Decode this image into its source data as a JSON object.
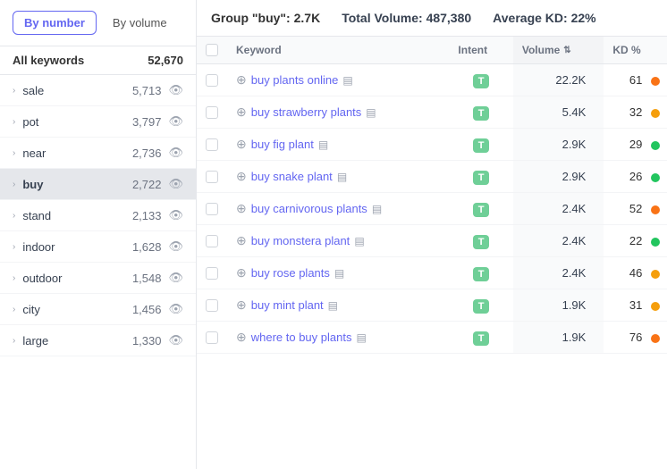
{
  "sidebar": {
    "buttons": {
      "by_number": "By number",
      "by_volume": "By volume"
    },
    "all_keywords_label": "All keywords",
    "all_keywords_count": "52,670",
    "items": [
      {
        "label": "sale",
        "count": "5,713"
      },
      {
        "label": "pot",
        "count": "3,797"
      },
      {
        "label": "near",
        "count": "2,736"
      },
      {
        "label": "buy",
        "count": "2,722",
        "active": true
      },
      {
        "label": "stand",
        "count": "2,133"
      },
      {
        "label": "indoor",
        "count": "1,628"
      },
      {
        "label": "outdoor",
        "count": "1,548"
      },
      {
        "label": "city",
        "count": "1,456"
      },
      {
        "label": "large",
        "count": "1,330"
      }
    ]
  },
  "header": {
    "group_label": "Group \"buy\":",
    "group_value": "2.7K",
    "total_volume_label": "Total Volume:",
    "total_volume_value": "487,380",
    "avg_kd_label": "Average KD:",
    "avg_kd_value": "22%"
  },
  "table": {
    "columns": {
      "checkbox": "",
      "keyword": "Keyword",
      "intent": "Intent",
      "volume": "Volume",
      "kd": "KD %"
    },
    "rows": [
      {
        "keyword": "buy plants online",
        "intent": "T",
        "volume": "22.2K",
        "kd": 61,
        "kd_color": "#f97316"
      },
      {
        "keyword": "buy strawberry plants",
        "intent": "T",
        "volume": "5.4K",
        "kd": 32,
        "kd_color": "#f59e0b"
      },
      {
        "keyword": "buy fig plant",
        "intent": "T",
        "volume": "2.9K",
        "kd": 29,
        "kd_color": "#22c55e"
      },
      {
        "keyword": "buy snake plant",
        "intent": "T",
        "volume": "2.9K",
        "kd": 26,
        "kd_color": "#22c55e"
      },
      {
        "keyword": "buy carnivorous plants",
        "intent": "T",
        "volume": "2.4K",
        "kd": 52,
        "kd_color": "#f97316"
      },
      {
        "keyword": "buy monstera plant",
        "intent": "T",
        "volume": "2.4K",
        "kd": 22,
        "kd_color": "#22c55e"
      },
      {
        "keyword": "buy rose plants",
        "intent": "T",
        "volume": "2.4K",
        "kd": 46,
        "kd_color": "#f59e0b"
      },
      {
        "keyword": "buy mint plant",
        "intent": "T",
        "volume": "1.9K",
        "kd": 31,
        "kd_color": "#f59e0b"
      },
      {
        "keyword": "where to buy plants",
        "intent": "T",
        "volume": "1.9K",
        "kd": 76,
        "kd_color": "#f97316"
      }
    ]
  }
}
